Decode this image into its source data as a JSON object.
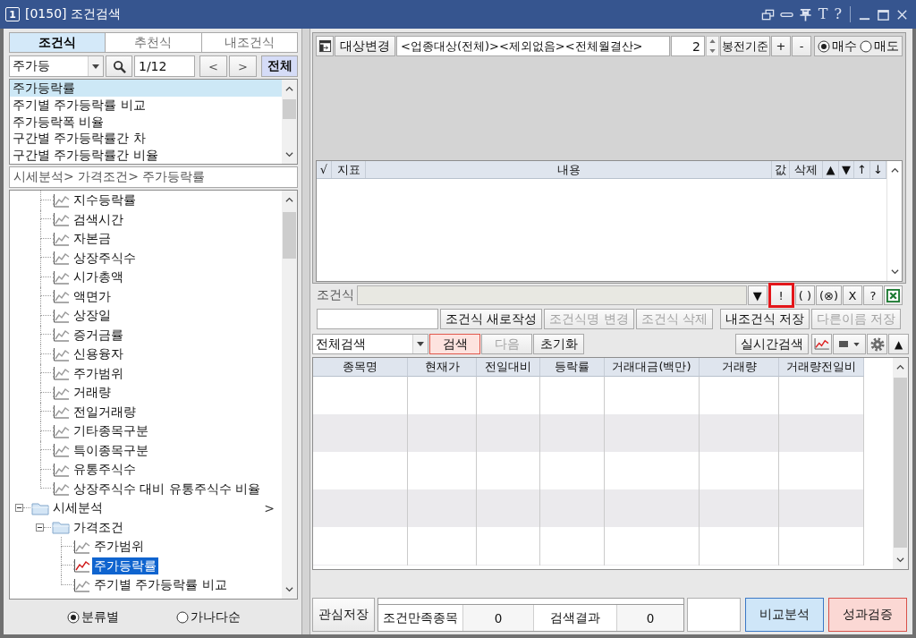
{
  "window": {
    "badge": "1",
    "title": "[0150] 조건검색",
    "tools": [
      "T",
      "?"
    ]
  },
  "left": {
    "tabs": [
      {
        "label": "조건식",
        "selected": true
      },
      {
        "label": "추천식",
        "selected": false
      },
      {
        "label": "내조건식",
        "selected": false
      }
    ],
    "search": {
      "category": "주가등",
      "page": "1/12",
      "prev": "<",
      "next": ">",
      "all": "전체"
    },
    "results": [
      {
        "label": "주가등락률",
        "selected": true
      },
      {
        "label": "주기별 주가등락률 비교",
        "selected": false
      },
      {
        "label": "주가등락폭 비율",
        "selected": false
      },
      {
        "label": "구간별 주가등락률간 차",
        "selected": false
      },
      {
        "label": "구간별 주가등락률간 비율",
        "selected": false
      }
    ],
    "path": "시세분석> 가격조건> 주가등락률",
    "tree": {
      "continued_items": [
        {
          "label": "지수등락률",
          "selected": false
        },
        {
          "label": "검색시간",
          "selected": false
        },
        {
          "label": "자본금",
          "selected": false
        },
        {
          "label": "상장주식수",
          "selected": false
        },
        {
          "label": "시가총액",
          "selected": false
        },
        {
          "label": "액면가",
          "selected": false
        },
        {
          "label": "상장일",
          "selected": false
        },
        {
          "label": "증거금률",
          "selected": false
        },
        {
          "label": "신용융자",
          "selected": false
        },
        {
          "label": "주가범위",
          "selected": false
        },
        {
          "label": "거래량",
          "selected": false
        },
        {
          "label": "전일거래량",
          "selected": false
        },
        {
          "label": "기타종목구분",
          "selected": false
        },
        {
          "label": "특이종목구분",
          "selected": false
        },
        {
          "label": "유통주식수",
          "selected": false
        },
        {
          "label": "상장주식수 대비 유통주식수 비율",
          "selected": false
        }
      ],
      "nodes": [
        {
          "label": "시세분석",
          "kind": "folder",
          "expanded": true,
          "selected": false,
          "suffix": ">",
          "children": [
            {
              "label": "가격조건",
              "kind": "folder",
              "expanded": true,
              "selected": false,
              "children": [
                {
                  "label": "주가범위",
                  "kind": "leaf",
                  "selected": false
                },
                {
                  "label": "주가등락률",
                  "kind": "leaf",
                  "selected": true
                },
                {
                  "label": "주기별 주가등락률 비교",
                  "kind": "leaf",
                  "selected": false
                }
              ]
            }
          ]
        }
      ]
    },
    "sort_options": [
      {
        "label": "분류별",
        "selected": true
      },
      {
        "label": "가나다순",
        "selected": false
      }
    ]
  },
  "target": {
    "button": "대상변경",
    "value": "<업종대상(전체)><제외없음><전체월결산>",
    "count": "2",
    "basis": "봉전기준",
    "plus": "+",
    "minus": "-",
    "sides": [
      {
        "label": "매수",
        "selected": true
      },
      {
        "label": "매도",
        "selected": false
      }
    ]
  },
  "conditions_grid": {
    "columns": [
      "√",
      "지표",
      "내용",
      "값",
      "삭제",
      "▲",
      "▼",
      "↑",
      "↓"
    ]
  },
  "formula": {
    "label": "조건식",
    "tools": [
      {
        "label": "▼",
        "highlighted": false
      },
      {
        "label": "!",
        "highlighted": true
      },
      {
        "label": "( )",
        "highlighted": false
      },
      {
        "label": "(⊗)",
        "highlighted": false
      },
      {
        "label": "X",
        "highlighted": false
      },
      {
        "label": "?",
        "highlighted": false
      }
    ]
  },
  "actions": {
    "edit": [
      {
        "label": "조건식 새로작성",
        "disabled": false
      },
      {
        "label": "조건식명 변경",
        "disabled": true
      },
      {
        "label": "조건식 삭제",
        "disabled": true
      }
    ],
    "save": [
      {
        "label": "내조건식 저장",
        "disabled": false
      },
      {
        "label": "다른이름 저장",
        "disabled": true
      }
    ]
  },
  "search_bar": {
    "scope": "전체검색",
    "buttons": [
      {
        "label": "검색",
        "kind": "primary",
        "disabled": false
      },
      {
        "label": "다음",
        "kind": "plain",
        "disabled": true
      },
      {
        "label": "초기화",
        "kind": "plain",
        "disabled": false
      }
    ],
    "realtime": "실시간검색",
    "collapse": "▲"
  },
  "results_table": {
    "columns": [
      "종목명",
      "현재가",
      "전일대비",
      "등락률",
      "거래대금(백만)",
      "거래량",
      "거래량전일비"
    ]
  },
  "footer": {
    "save": "관심저장",
    "progress": {
      "level": 0
    },
    "stats": [
      {
        "label": "조건만족종목",
        "value": "0"
      },
      {
        "label": "검색결과",
        "value": "0"
      }
    ],
    "buttons": [
      {
        "label": "비교분석",
        "kind": "compare"
      },
      {
        "label": "성과검증",
        "kind": "verify"
      }
    ]
  }
}
